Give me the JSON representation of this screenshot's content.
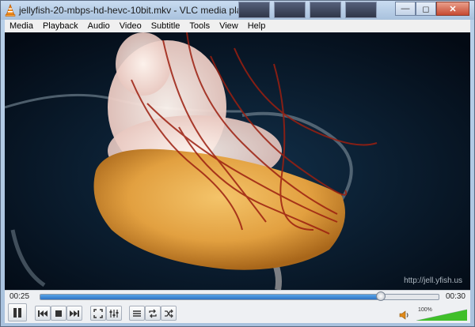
{
  "window": {
    "title": "jellyfish-20-mbps-hd-hevc-10bit.mkv - VLC media player",
    "minimize_label": "—",
    "maximize_label": "◻",
    "close_label": "✕"
  },
  "menubar": {
    "items": [
      {
        "label": "Media"
      },
      {
        "label": "Playback"
      },
      {
        "label": "Audio"
      },
      {
        "label": "Video"
      },
      {
        "label": "Subtitle"
      },
      {
        "label": "Tools"
      },
      {
        "label": "View"
      },
      {
        "label": "Help"
      }
    ]
  },
  "video": {
    "watermark": "http://jell.yfish.us"
  },
  "controls": {
    "current_time": "00:25",
    "total_time": "00:30",
    "progress_fraction": 0.855,
    "volume_label": "100%",
    "volume_fraction": 1.0,
    "buttons": [
      {
        "icon": "pause-icon"
      },
      {
        "icon": "previous-icon"
      },
      {
        "icon": "stop-icon"
      },
      {
        "icon": "next-icon"
      },
      {
        "icon": "fullscreen-icon"
      },
      {
        "icon": "extended-settings-icon"
      },
      {
        "icon": "playlist-icon"
      },
      {
        "icon": "loop-icon"
      },
      {
        "icon": "shuffle-icon"
      }
    ]
  },
  "colors": {
    "accent": "#2c72c4",
    "volume_green": "#3fbf2a"
  }
}
